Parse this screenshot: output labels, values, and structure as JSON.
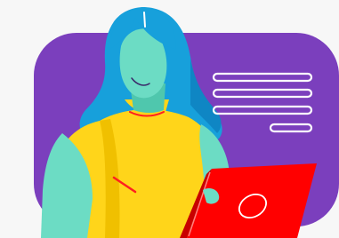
{
  "illustration": {
    "subject": "woman-using-laptop",
    "icons": [
      "text-lines-icon",
      "laptop-logo-icon"
    ],
    "colors": {
      "background": "#f7f7f7",
      "panel": "#7b3fbd",
      "hair": "#17a0db",
      "hair_shadow": "#0f86c4",
      "skin": "#6cdcc4",
      "skin_shadow": "#4fc7ad",
      "sweater": "#ffd51a",
      "sweater_shadow": "#f0c000",
      "accent_lines": "#ff1f1f",
      "laptop": "#ff0000",
      "laptop_dark": "#c80000",
      "text_lines": "#ffffff"
    }
  }
}
